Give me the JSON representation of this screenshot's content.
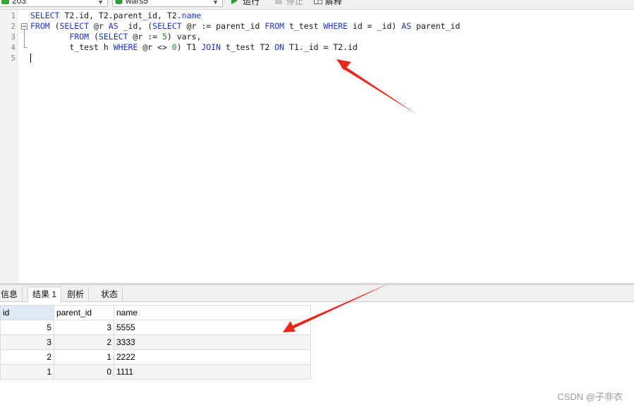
{
  "toolbar": {
    "connection": "203",
    "database": "wars5",
    "run_label": "运行",
    "stop_label": "停止",
    "explain_label": "解释"
  },
  "editor": {
    "line_numbers": [
      "1",
      "2",
      "3",
      "4",
      "5"
    ]
  },
  "tabs": [
    {
      "label": "信息"
    },
    {
      "label": "结果 1"
    },
    {
      "label": "剖析"
    },
    {
      "label": "状态"
    }
  ],
  "grid": {
    "columns": [
      "id",
      "parent_id",
      "name"
    ],
    "rows": [
      [
        "5",
        "3",
        "5555"
      ],
      [
        "3",
        "2",
        "3333"
      ],
      [
        "2",
        "1",
        "2222"
      ],
      [
        "1",
        "0",
        "1111"
      ]
    ]
  },
  "watermark": "CSDN @子非衣",
  "colors": {
    "keyword": "#1b33d6",
    "number": "#1a8f1a",
    "arrow": "#e8261c"
  }
}
